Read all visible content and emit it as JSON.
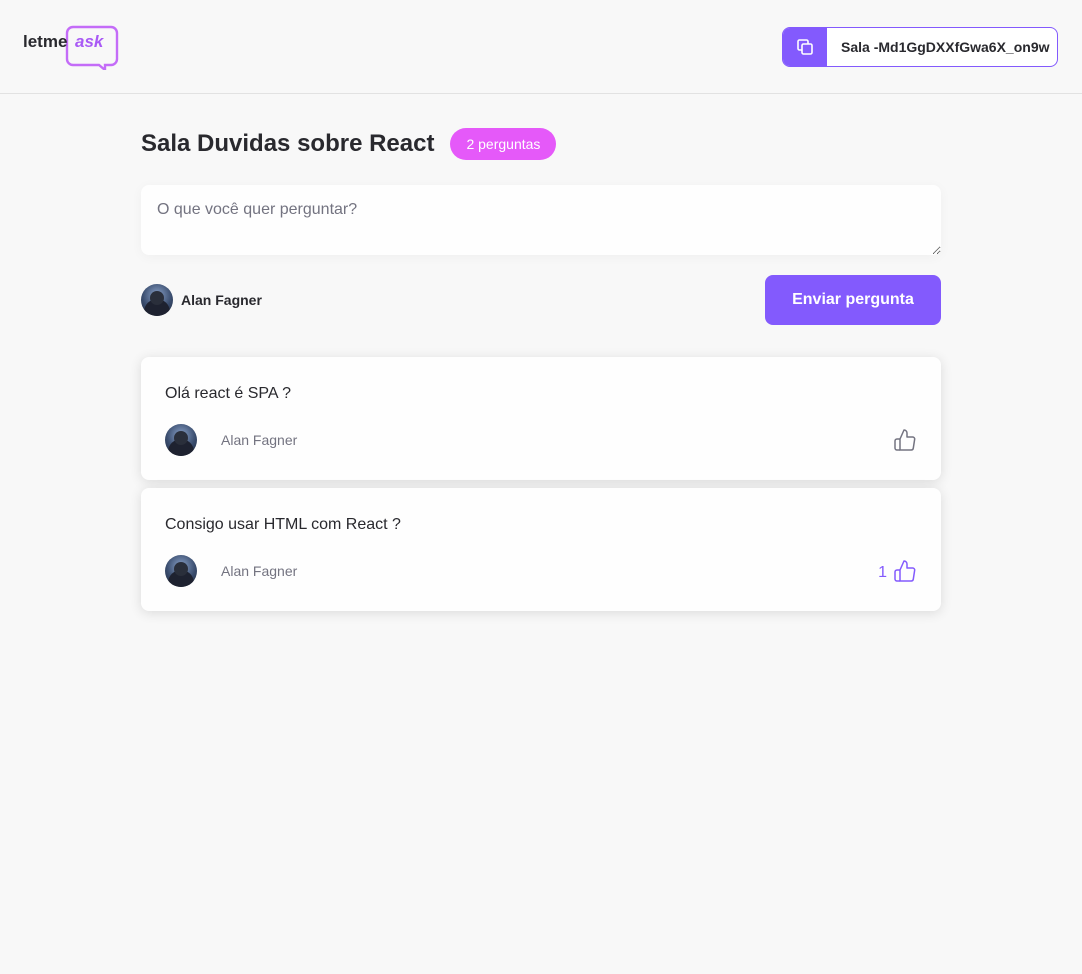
{
  "logo": {
    "text_main": "letme",
    "text_accent": "ask"
  },
  "header": {
    "room_code": "Sala -Md1GgDXXfGwa6X_on9w"
  },
  "room": {
    "title": "Sala Duvidas sobre React",
    "badge": "2 perguntas"
  },
  "form": {
    "placeholder": "O que você quer perguntar?",
    "user_name": "Alan Fagner",
    "send_label": "Enviar pergunta"
  },
  "questions": [
    {
      "content": "Olá react é SPA ?",
      "author": "Alan Fagner",
      "likes": ""
    },
    {
      "content": "Consigo usar HTML com React ?",
      "author": "Alan Fagner",
      "likes": "1"
    }
  ],
  "colors": {
    "primary": "#835afd",
    "pink": "#e559f9",
    "background": "#f8f8f8",
    "text": "#29292e",
    "muted": "#737380"
  }
}
